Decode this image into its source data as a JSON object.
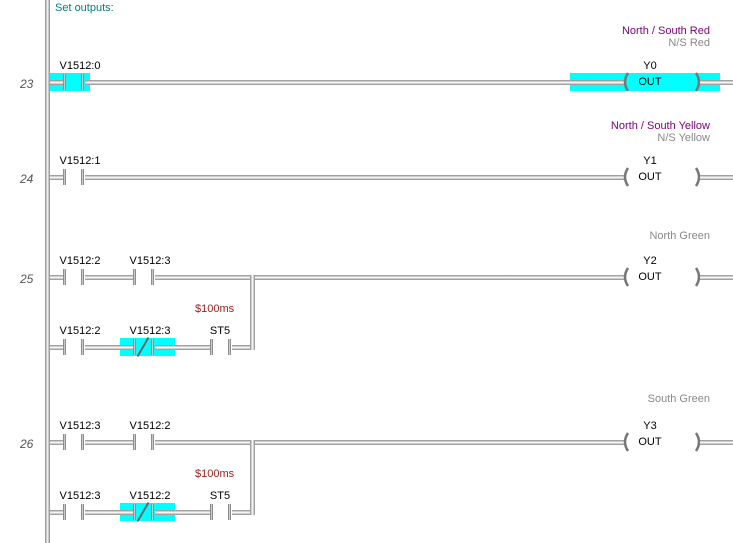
{
  "header": {
    "set_outputs": "Set outputs:"
  },
  "rungs": {
    "r23": {
      "num": "23",
      "contact": "V1512:0",
      "coil": {
        "title": "North / South Red",
        "sub": "N/S Red",
        "addr": "Y0",
        "op": "OUT"
      },
      "active": true
    },
    "r24": {
      "num": "24",
      "contact": "V1512:1",
      "coil": {
        "title": "North / South Yellow",
        "sub": "N/S Yellow",
        "addr": "Y1",
        "op": "OUT"
      }
    },
    "r25": {
      "num": "25",
      "c1": "V1512:2",
      "c2": "V1512:3",
      "b1": "V1512:2",
      "b2": "V1512:3",
      "b3": "ST5",
      "timer": "$100ms",
      "coil": {
        "title": "North Green",
        "addr": "Y2",
        "op": "OUT"
      }
    },
    "r26": {
      "num": "26",
      "c1": "V1512:3",
      "c2": "V1512:2",
      "b1": "V1512:3",
      "b2": "V1512:2",
      "b3": "ST5",
      "timer": "$100ms",
      "coil": {
        "title": "South Green",
        "addr": "Y3",
        "op": "OUT"
      }
    }
  }
}
